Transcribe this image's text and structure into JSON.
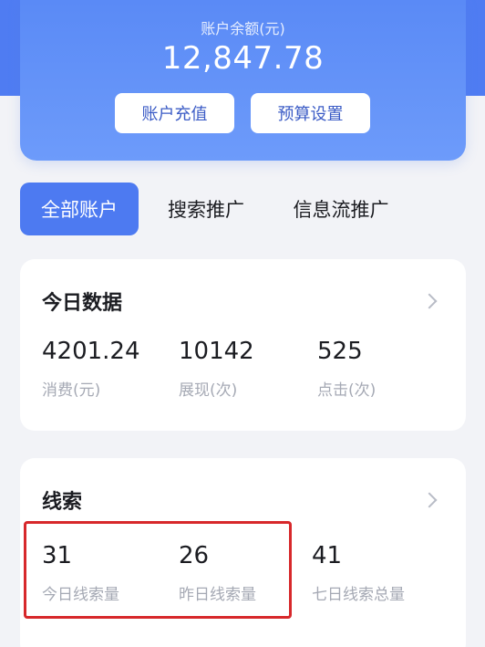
{
  "balance": {
    "label": "账户余额(元)",
    "value": "12,847.78",
    "recharge_label": "账户充值",
    "budget_label": "预算设置"
  },
  "tabs": [
    {
      "label": "全部账户",
      "active": true
    },
    {
      "label": "搜索推广",
      "active": false
    },
    {
      "label": "信息流推广",
      "active": false
    }
  ],
  "today": {
    "title": "今日数据",
    "metrics": [
      {
        "value": "4201.24",
        "label": "消费(元)"
      },
      {
        "value": "10142",
        "label": "展现(次)"
      },
      {
        "value": "525",
        "label": "点击(次)"
      }
    ]
  },
  "leads": {
    "title": "线索",
    "metrics": [
      {
        "value": "31",
        "label": "今日线索量"
      },
      {
        "value": "26",
        "label": "昨日线索量"
      },
      {
        "value": "41",
        "label": "七日线索总量"
      }
    ]
  },
  "colors": {
    "accent": "#4d7af1",
    "highlight": "#d7282b"
  }
}
